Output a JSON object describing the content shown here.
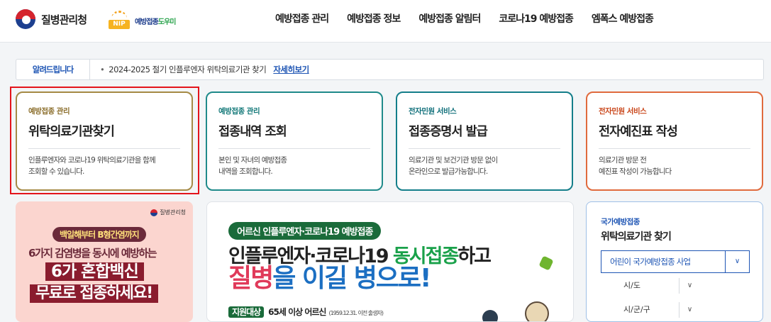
{
  "header": {
    "logo_kdca": "질병관리청",
    "logo_nip_mark": "NIP",
    "logo_nip_text1": "예방접종",
    "logo_nip_text2": "도우미",
    "nav": [
      "예방접종 관리",
      "예방접종 정보",
      "예방접종 알림터",
      "코로나19 예방접종",
      "엠폭스 예방접종"
    ]
  },
  "notice": {
    "label": "알려드립니다",
    "bullet": "•",
    "message": "2024-2025 절기 인플루엔자 위탁의료기관 찾기",
    "more": "자세히보기"
  },
  "cards": [
    {
      "category": "예방접종 관리",
      "title": "위탁의료기관찾기",
      "desc1": "인플루엔자와 코로나19 위탁의료기관을 함께",
      "desc2": "조회할 수 있습니다."
    },
    {
      "category": "예방접종 관리",
      "title": "접종내역 조회",
      "desc1": "본인 및 자녀의 예방접종",
      "desc2": "내역을 조회합니다."
    },
    {
      "category": "전자민원 서비스",
      "title": "접종증명서 발급",
      "desc1": "의료기관 및 보건기관 방문 없이",
      "desc2": "온라인으로 발급가능합니다."
    },
    {
      "category": "전자민원 서비스",
      "title": "전자예진표 작성",
      "desc1": "의료기관 방문 전",
      "desc2": "예진표 작성이 가능합니다"
    }
  ],
  "banner1": {
    "kdca": "질병관리청",
    "line1": "백일해부터 B형간염까지",
    "line2": "6가지 감염병을 동시에 예방하는",
    "line3": "6가 혼합백신",
    "line4": "무료로 접종하세요!"
  },
  "banner2": {
    "pill": "어르신 인플루엔자·코로나19 예방접종",
    "line2a": "인플루엔자·코로나19 ",
    "line2b": "동시접종",
    "line2c": "하고",
    "line3a": "질병",
    "line3b": "을 ",
    "line3c": "이길",
    "line3d": " 병으로!",
    "tag": "지원대상",
    "target": "65세 이상 어르신",
    "target_note": "(1959.12.31. 이전 출생자)"
  },
  "side": {
    "category": "국가예방접종",
    "title": "위탁의료기관 찾기",
    "program": "어린이 국가예방접종 사업",
    "sido": "시/도",
    "sigungu": "시/군/구"
  }
}
